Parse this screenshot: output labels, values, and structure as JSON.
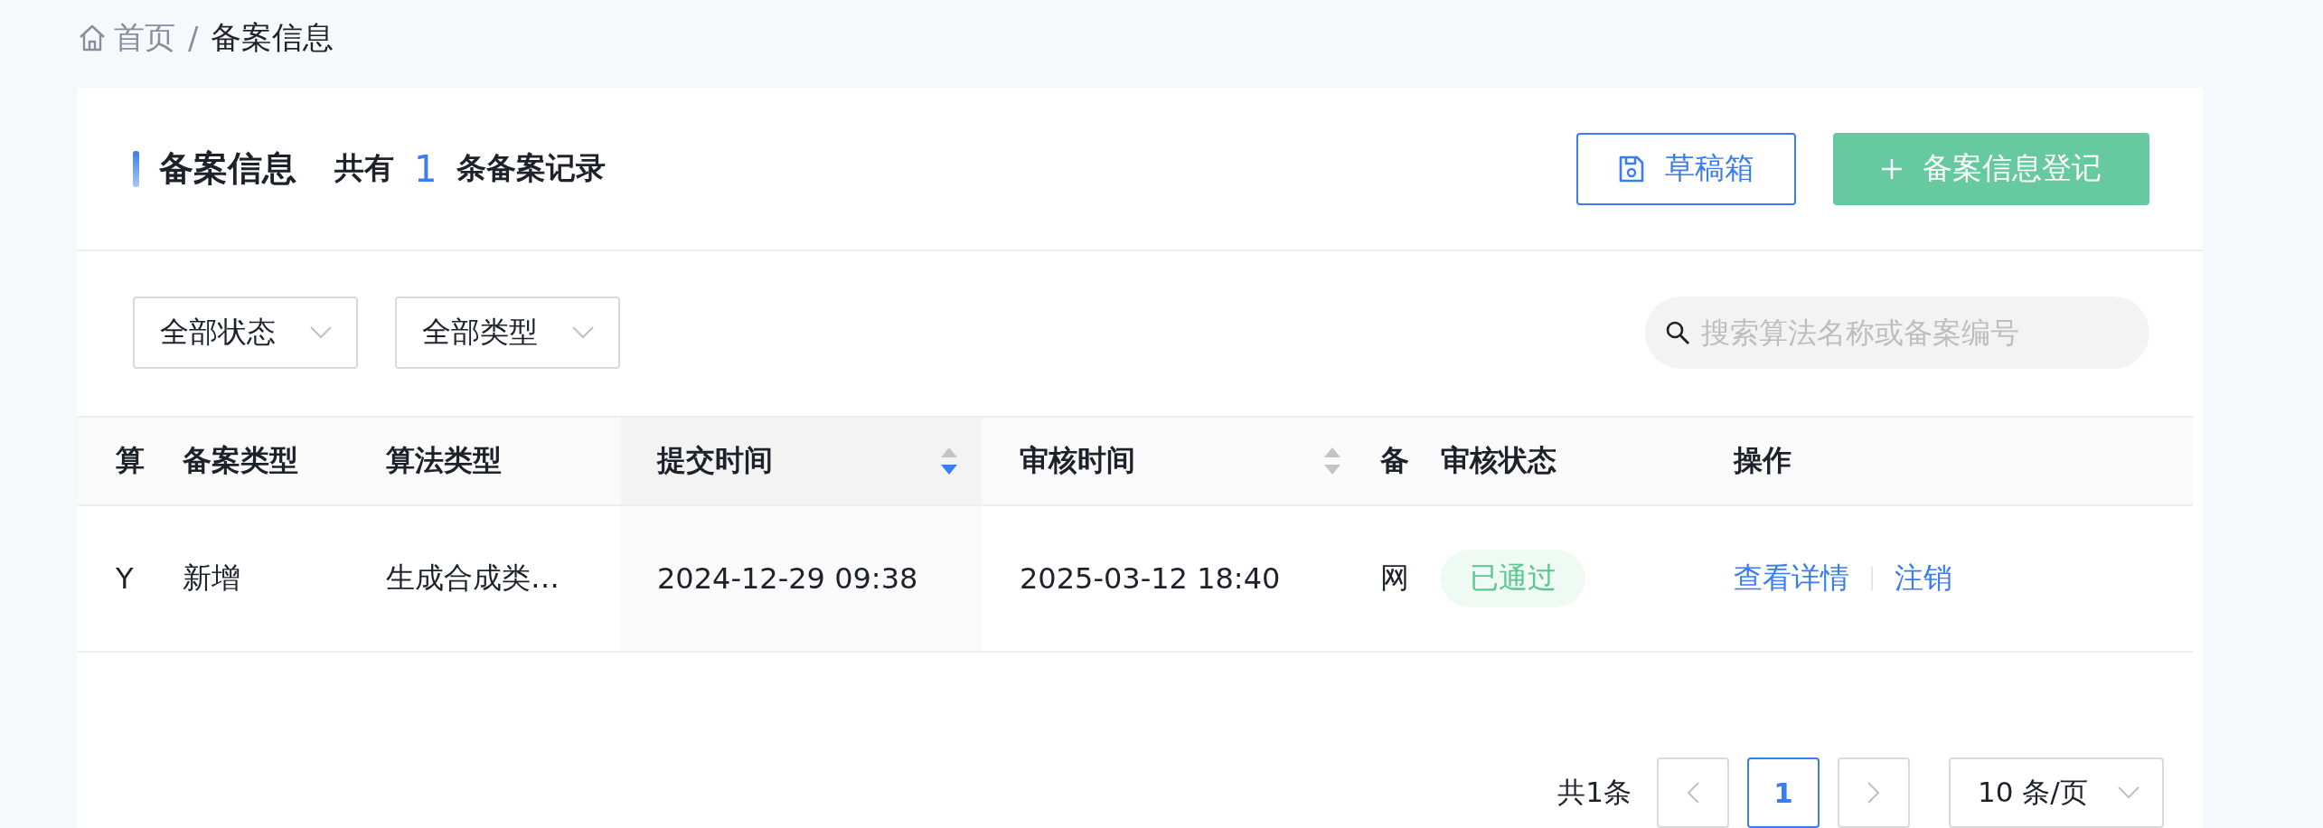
{
  "breadcrumb": [
    {
      "label": "首页",
      "kind": "home"
    },
    {
      "label": "备案信息",
      "kind": "current",
      "separator": "/"
    }
  ],
  "header": {
    "title": "备案信息",
    "count_prefix": "共有",
    "count": "1",
    "count_suffix": "条备案记录"
  },
  "buttons": [
    {
      "label": "草稿箱",
      "kind": "outline"
    },
    {
      "label": "备案信息登记",
      "kind": "primary"
    }
  ],
  "filters": [
    {
      "value": "全部状态"
    },
    {
      "value": "全部类型"
    }
  ],
  "search": {
    "placeholder": "搜索算法名称或备案编号"
  },
  "table": {
    "columns": [
      {
        "label": "算"
      },
      {
        "label": "备案类型"
      },
      {
        "label": "算法类型"
      },
      {
        "label": "提交时间",
        "sorted": true
      },
      {
        "label": "审核时间",
        "sorted": false
      },
      {
        "label": "备"
      },
      {
        "label": "审核状态"
      },
      {
        "label": "操作"
      }
    ],
    "rows": [
      {
        "cells": [
          "Y",
          "新增",
          "生成合成类…",
          "2024-12-29 09:38",
          "2025-03-12 18:40",
          "网"
        ],
        "status": {
          "label": "已通过",
          "kind": "approved"
        },
        "actions": [
          "查看详情",
          "注销"
        ]
      }
    ]
  },
  "pagination": {
    "total": "共1条",
    "pages": [
      {
        "label": "1",
        "selected": true
      }
    ],
    "page_size": "10 条/页"
  }
}
